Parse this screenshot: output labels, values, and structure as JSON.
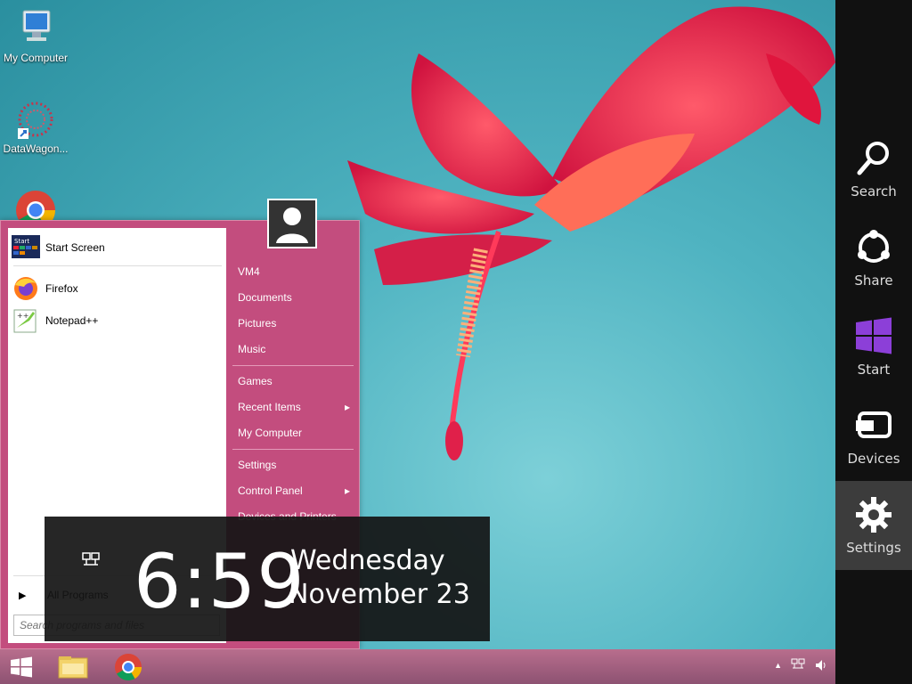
{
  "desktop": {
    "icons": [
      {
        "label": "My Computer"
      },
      {
        "label": "DataWagon..."
      },
      {
        "label": ""
      }
    ]
  },
  "start_menu": {
    "pinned": [
      {
        "label": "Start Screen",
        "icon": "start-screen-icon"
      },
      {
        "label": "Firefox",
        "icon": "firefox-icon"
      },
      {
        "label": "Notepad++",
        "icon": "notepad-plus-plus-icon"
      }
    ],
    "right_items": [
      {
        "label": "VM4",
        "arrow": false
      },
      {
        "label": "Documents",
        "arrow": false
      },
      {
        "label": "Pictures",
        "arrow": false
      },
      {
        "label": "Music",
        "arrow": false
      },
      {
        "label": "Games",
        "arrow": false
      },
      {
        "label": "Recent Items",
        "arrow": true
      },
      {
        "label": "My Computer",
        "arrow": false
      },
      {
        "label": "Settings",
        "arrow": false
      },
      {
        "label": "Control Panel",
        "arrow": true
      },
      {
        "label": "Devices and Printers",
        "arrow": false
      }
    ],
    "all_programs_label": "All Programs",
    "search_placeholder": "Search programs and files",
    "arrow_glyph": "▸",
    "accent": "#c34d7e"
  },
  "clock": {
    "time": "6:59",
    "day": "Wednesday",
    "date": "November 23"
  },
  "charms": [
    {
      "label": "Search",
      "icon": "search-icon"
    },
    {
      "label": "Share",
      "icon": "share-icon"
    },
    {
      "label": "Start",
      "icon": "windows-logo-icon"
    },
    {
      "label": "Devices",
      "icon": "devices-icon"
    },
    {
      "label": "Settings",
      "icon": "gear-icon",
      "active": true
    }
  ],
  "taskbar": {
    "apps": [
      {
        "icon": "windows-start-icon"
      },
      {
        "icon": "file-explorer-icon"
      },
      {
        "icon": "chrome-icon"
      }
    ],
    "tray_glyph": "▲"
  }
}
